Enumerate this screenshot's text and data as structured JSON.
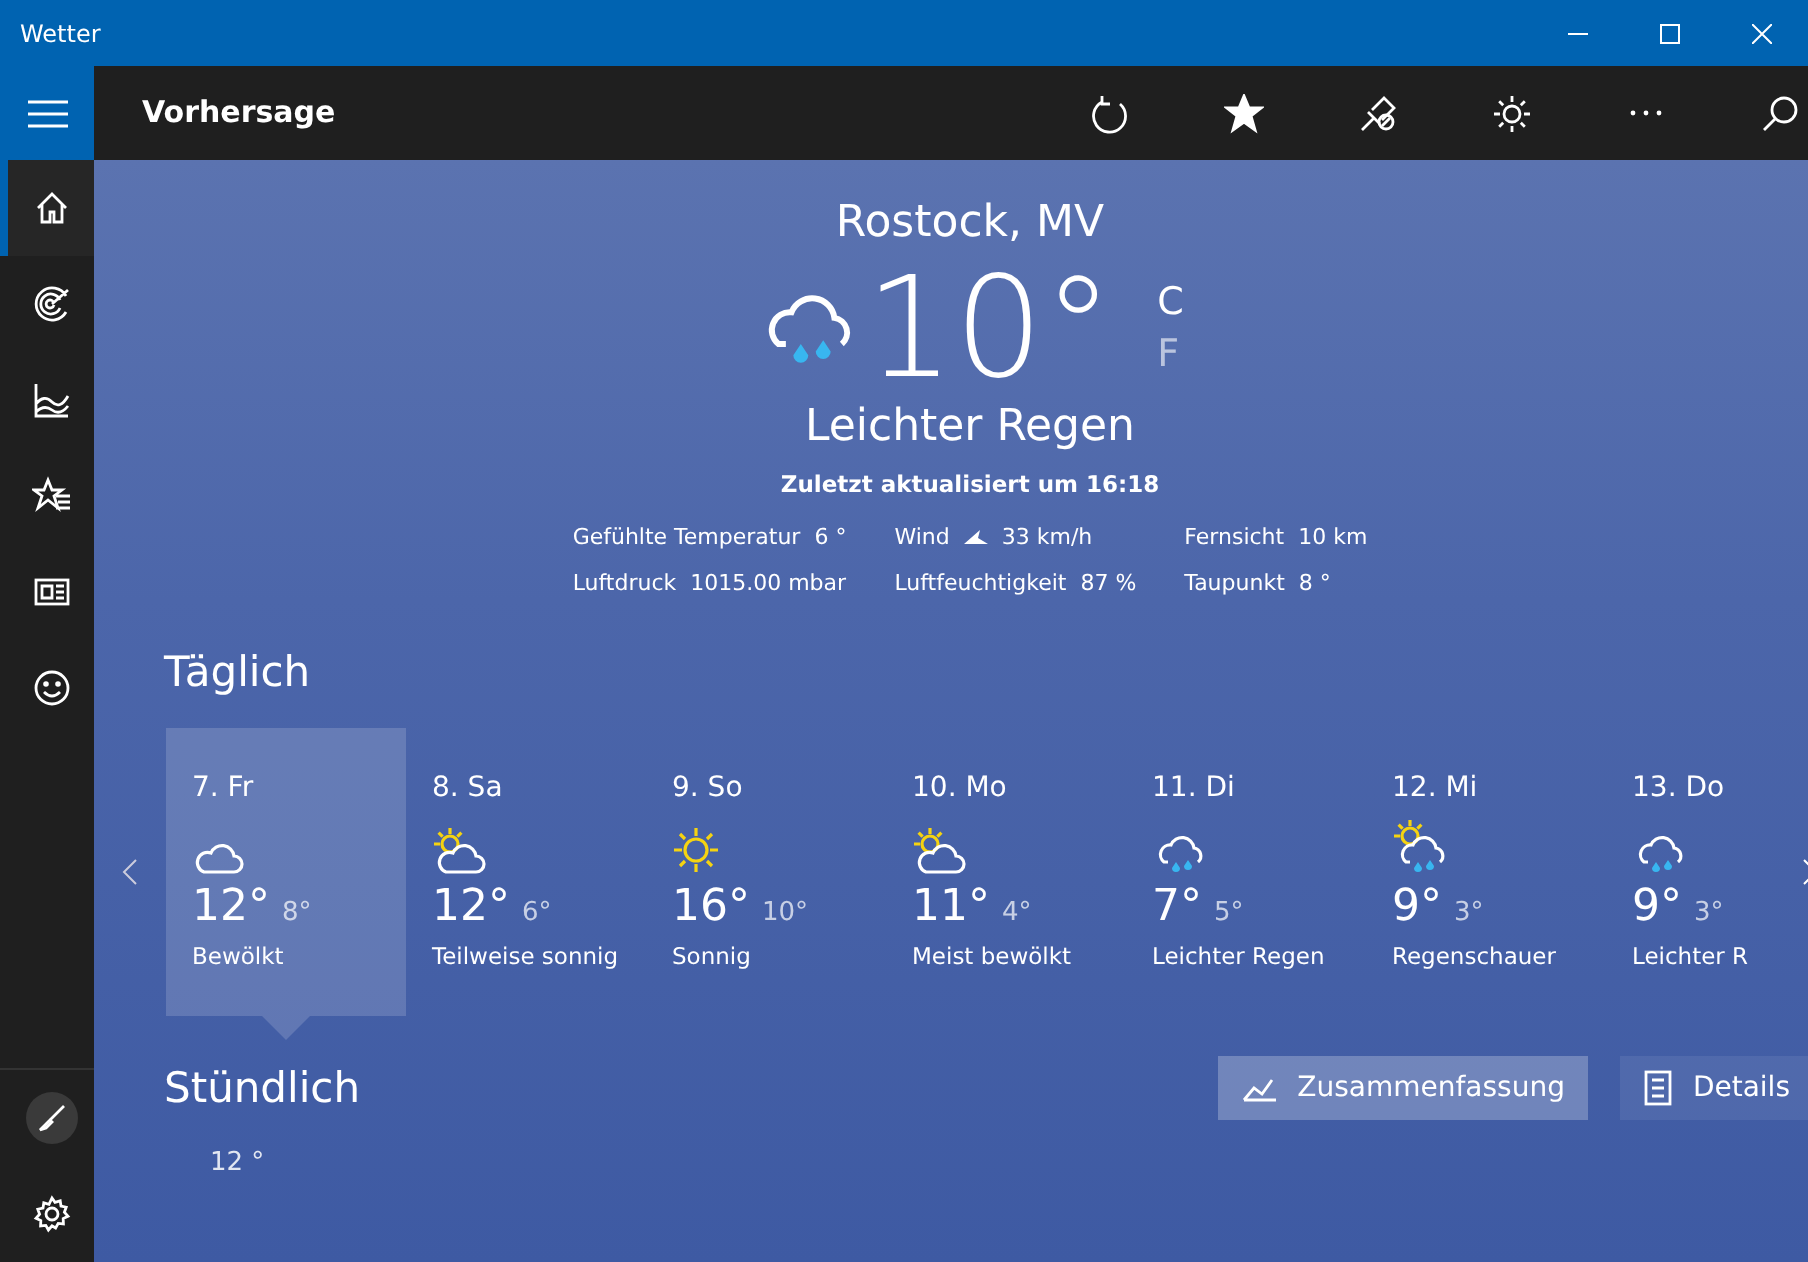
{
  "window": {
    "title": "Wetter"
  },
  "appbar": {
    "title": "Vorhersage"
  },
  "sidebar": {
    "items": [
      {
        "kind": "home",
        "selected": true
      },
      {
        "kind": "radar",
        "selected": false
      },
      {
        "kind": "chart",
        "selected": false
      },
      {
        "kind": "favorites",
        "selected": false
      },
      {
        "kind": "news",
        "selected": false
      },
      {
        "kind": "smiley",
        "selected": false
      }
    ]
  },
  "current": {
    "location": "Rostock, MV",
    "kind": "rain",
    "temperature": "10°",
    "units": [
      {
        "label": "C",
        "selected": true
      },
      {
        "label": "F",
        "selected": false
      }
    ],
    "condition": "Leichter Regen",
    "updated": "Zuletzt aktualisiert um 16:18",
    "details": [
      {
        "label": "Gefühlte Temperatur",
        "value": "6 °"
      },
      {
        "label": "Wind",
        "value": "33 km/h",
        "kind": "wind"
      },
      {
        "label": "Fernsicht",
        "value": "10 km"
      },
      {
        "label": "Luftdruck",
        "value": "1015.00 mbar"
      },
      {
        "label": "Luftfeuchtigkeit",
        "value": "87 %"
      },
      {
        "label": "Taupunkt",
        "value": "8 °"
      }
    ]
  },
  "daily": {
    "title": "Täglich",
    "days": [
      {
        "date": "7. Fr",
        "kind": "cloudy",
        "high": "12°",
        "low": "8°",
        "condition": "Bewölkt",
        "selected": true
      },
      {
        "date": "8. Sa",
        "kind": "partly-sunny",
        "high": "12°",
        "low": "6°",
        "condition": "Teilweise sonnig",
        "selected": false
      },
      {
        "date": "9. So",
        "kind": "sunny",
        "high": "16°",
        "low": "10°",
        "condition": "Sonnig",
        "selected": false
      },
      {
        "date": "10. Mo",
        "kind": "partly-sunny",
        "high": "11°",
        "low": "4°",
        "condition": "Meist bewölkt",
        "selected": false
      },
      {
        "date": "11. Di",
        "kind": "rain",
        "high": "7°",
        "low": "5°",
        "condition": "Leichter Regen",
        "selected": false
      },
      {
        "date": "12. Mi",
        "kind": "sun-rain",
        "high": "9°",
        "low": "3°",
        "condition": "Regenschauer",
        "selected": false
      },
      {
        "date": "13. Do",
        "kind": "rain",
        "high": "9°",
        "low": "3°",
        "condition": "Leichter R",
        "selected": false
      }
    ]
  },
  "hourly": {
    "title": "Stündlich",
    "views": [
      {
        "label": "Zusammenfassung",
        "kind": "summary",
        "selected": true
      },
      {
        "label": "Details",
        "kind": "details",
        "selected": false
      }
    ],
    "first_temperature": "12 °"
  }
}
